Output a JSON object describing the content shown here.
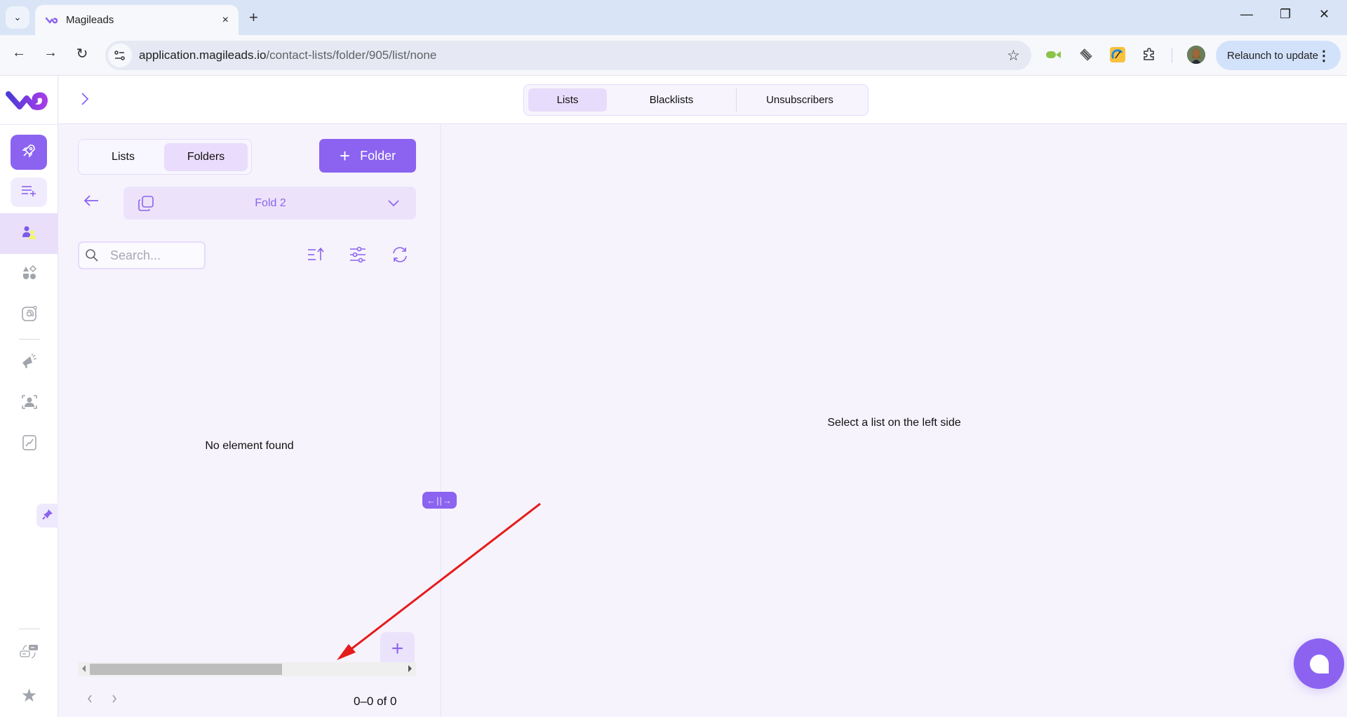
{
  "browser": {
    "tab": {
      "title": "Magileads",
      "close_label": "×"
    },
    "new_tab_label": "+",
    "url": {
      "host": "application.magileads.io",
      "path": "/contact-lists/folder/905/list/none"
    },
    "relaunch_label": "Relaunch to update",
    "window_controls": {
      "minimize": "—",
      "restore": "❐",
      "close": "✕"
    }
  },
  "header": {
    "tabs": [
      {
        "label": "Lists",
        "active": true
      },
      {
        "label": "Blacklists",
        "active": false
      },
      {
        "label": "Unsubscribers",
        "active": false
      }
    ]
  },
  "sidebar": {
    "items": [
      {
        "icon": "rocket-icon"
      },
      {
        "icon": "playlist-add-icon"
      },
      {
        "icon": "contacts-icon",
        "active": true
      },
      {
        "icon": "shapes-icon"
      },
      {
        "icon": "email-at-icon"
      },
      {
        "icon": "megaphone-icon"
      },
      {
        "icon": "person-scan-icon"
      },
      {
        "icon": "chart-line-icon"
      },
      {
        "icon": "integrations-icon"
      },
      {
        "icon": "star-icon"
      }
    ]
  },
  "left_panel": {
    "view_toggle": [
      {
        "label": "Lists",
        "active": false
      },
      {
        "label": "Folders",
        "active": true
      }
    ],
    "add_folder_label": "Folder",
    "current_folder": "Fold 2",
    "search": {
      "placeholder": "Search...",
      "value": ""
    },
    "empty_message": "No element found",
    "pagination": {
      "range_label": "0–0 of 0"
    }
  },
  "right_panel": {
    "message": "Select a list on the left side"
  },
  "splitter_label": "←||→",
  "colors": {
    "accent": "#8b63f0",
    "accent_soft": "#ece3fb",
    "background": "#f6f3fd",
    "annotation_arrow": "#e51b1b"
  }
}
